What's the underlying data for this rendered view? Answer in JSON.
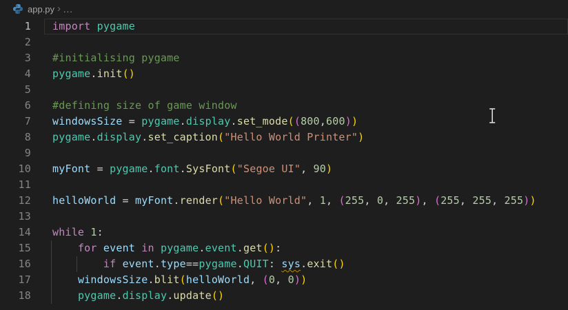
{
  "breadcrumbs": {
    "file_name": "app.py",
    "separator_icon": "›",
    "ellipsis": "..."
  },
  "mouse_cursor": "i-beam",
  "editor": {
    "active_line": 1,
    "colors": {
      "background": "#1E1E1E",
      "breadcrumb_text": "#A6A6A6",
      "line_number": "#858585",
      "line_number_active": "#C6C6C6",
      "keyword": "#C586C0",
      "module": "#4EC9B0",
      "function": "#DCDCAA",
      "variable": "#9CDCFE",
      "string": "#CE9178",
      "number": "#B5CEA8",
      "comment": "#6A9955",
      "punctuation": "#D4D4D4",
      "bracket_level1": "#FFD700",
      "bracket_level2": "#DA70D6",
      "warning_underline": "#B58B00",
      "indent_guide": "#404040",
      "line_highlight_border": "#323232",
      "python_icon_light": "#4B8BBE",
      "python_icon_dark": "#306998"
    },
    "lines": [
      {
        "n": "1",
        "guides": 0,
        "segs": [
          [
            "kw",
            "import"
          ],
          [
            "pun",
            " "
          ],
          [
            "mod",
            "pygame"
          ]
        ]
      },
      {
        "n": "2",
        "guides": 0,
        "segs": []
      },
      {
        "n": "3",
        "guides": 0,
        "segs": [
          [
            "com",
            "#initialising pygame"
          ]
        ]
      },
      {
        "n": "4",
        "guides": 0,
        "segs": [
          [
            "mod",
            "pygame"
          ],
          [
            "pun",
            "."
          ],
          [
            "fn",
            "init"
          ],
          [
            "b1",
            "()"
          ]
        ]
      },
      {
        "n": "5",
        "guides": 0,
        "segs": []
      },
      {
        "n": "6",
        "guides": 0,
        "segs": [
          [
            "com",
            "#defining size of game window"
          ]
        ]
      },
      {
        "n": "7",
        "guides": 0,
        "segs": [
          [
            "var",
            "windowsSize"
          ],
          [
            "pun",
            " = "
          ],
          [
            "mod",
            "pygame"
          ],
          [
            "pun",
            "."
          ],
          [
            "mod",
            "display"
          ],
          [
            "pun",
            "."
          ],
          [
            "fn",
            "set_mode"
          ],
          [
            "b1",
            "("
          ],
          [
            "b2",
            "("
          ],
          [
            "num",
            "800"
          ],
          [
            "pun",
            ","
          ],
          [
            "num",
            "600"
          ],
          [
            "b2",
            ")"
          ],
          [
            "b1",
            ")"
          ]
        ]
      },
      {
        "n": "8",
        "guides": 0,
        "segs": [
          [
            "mod",
            "pygame"
          ],
          [
            "pun",
            "."
          ],
          [
            "mod",
            "display"
          ],
          [
            "pun",
            "."
          ],
          [
            "fn",
            "set_caption"
          ],
          [
            "b1",
            "("
          ],
          [
            "str",
            "\"Hello World Printer\""
          ],
          [
            "b1",
            ")"
          ]
        ]
      },
      {
        "n": "9",
        "guides": 0,
        "segs": []
      },
      {
        "n": "10",
        "guides": 0,
        "segs": [
          [
            "var",
            "myFont"
          ],
          [
            "pun",
            " = "
          ],
          [
            "mod",
            "pygame"
          ],
          [
            "pun",
            "."
          ],
          [
            "mod",
            "font"
          ],
          [
            "pun",
            "."
          ],
          [
            "fn",
            "SysFont"
          ],
          [
            "b1",
            "("
          ],
          [
            "str",
            "\"Segoe UI\""
          ],
          [
            "pun",
            ", "
          ],
          [
            "num",
            "90"
          ],
          [
            "b1",
            ")"
          ]
        ]
      },
      {
        "n": "11",
        "guides": 0,
        "segs": []
      },
      {
        "n": "12",
        "guides": 0,
        "segs": [
          [
            "var",
            "helloWorld"
          ],
          [
            "pun",
            " = "
          ],
          [
            "var",
            "myFont"
          ],
          [
            "pun",
            "."
          ],
          [
            "fn",
            "render"
          ],
          [
            "b1",
            "("
          ],
          [
            "str",
            "\"Hello World\""
          ],
          [
            "pun",
            ", "
          ],
          [
            "num",
            "1"
          ],
          [
            "pun",
            ", "
          ],
          [
            "b2",
            "("
          ],
          [
            "num",
            "255"
          ],
          [
            "pun",
            ", "
          ],
          [
            "num",
            "0"
          ],
          [
            "pun",
            ", "
          ],
          [
            "num",
            "255"
          ],
          [
            "b2",
            ")"
          ],
          [
            "pun",
            ", "
          ],
          [
            "b2",
            "("
          ],
          [
            "num",
            "255"
          ],
          [
            "pun",
            ", "
          ],
          [
            "num",
            "255"
          ],
          [
            "pun",
            ", "
          ],
          [
            "num",
            "255"
          ],
          [
            "b2",
            ")"
          ],
          [
            "b1",
            ")"
          ]
        ]
      },
      {
        "n": "13",
        "guides": 0,
        "segs": []
      },
      {
        "n": "14",
        "guides": 0,
        "segs": [
          [
            "kw",
            "while"
          ],
          [
            "pun",
            " "
          ],
          [
            "num",
            "1"
          ],
          [
            "pun",
            ":"
          ]
        ]
      },
      {
        "n": "15",
        "guides": 1,
        "segs": [
          [
            "pun",
            "    "
          ],
          [
            "kw",
            "for"
          ],
          [
            "pun",
            " "
          ],
          [
            "var",
            "event"
          ],
          [
            "pun",
            " "
          ],
          [
            "kw",
            "in"
          ],
          [
            "pun",
            " "
          ],
          [
            "mod",
            "pygame"
          ],
          [
            "pun",
            "."
          ],
          [
            "mod",
            "event"
          ],
          [
            "pun",
            "."
          ],
          [
            "fn",
            "get"
          ],
          [
            "b1",
            "()"
          ],
          [
            "pun",
            ":"
          ]
        ]
      },
      {
        "n": "16",
        "guides": 2,
        "segs": [
          [
            "pun",
            "        "
          ],
          [
            "kw",
            "if"
          ],
          [
            "pun",
            " "
          ],
          [
            "var",
            "event"
          ],
          [
            "pun",
            "."
          ],
          [
            "var",
            "type"
          ],
          [
            "pun",
            "=="
          ],
          [
            "mod",
            "pygame"
          ],
          [
            "pun",
            "."
          ],
          [
            "mod",
            "QUIT"
          ],
          [
            "pun",
            ": "
          ],
          [
            "warn",
            "sys"
          ],
          [
            "pun",
            "."
          ],
          [
            "fn",
            "exit"
          ],
          [
            "b1",
            "()"
          ]
        ]
      },
      {
        "n": "17",
        "guides": 1,
        "segs": [
          [
            "pun",
            "    "
          ],
          [
            "var",
            "windowsSize"
          ],
          [
            "pun",
            "."
          ],
          [
            "fn",
            "blit"
          ],
          [
            "b1",
            "("
          ],
          [
            "var",
            "helloWorld"
          ],
          [
            "pun",
            ", "
          ],
          [
            "b2",
            "("
          ],
          [
            "num",
            "0"
          ],
          [
            "pun",
            ", "
          ],
          [
            "num",
            "0"
          ],
          [
            "b2",
            ")"
          ],
          [
            "b1",
            ")"
          ]
        ]
      },
      {
        "n": "18",
        "guides": 1,
        "segs": [
          [
            "pun",
            "    "
          ],
          [
            "mod",
            "pygame"
          ],
          [
            "pun",
            "."
          ],
          [
            "mod",
            "display"
          ],
          [
            "pun",
            "."
          ],
          [
            "fn",
            "update"
          ],
          [
            "b1",
            "()"
          ]
        ]
      }
    ]
  }
}
